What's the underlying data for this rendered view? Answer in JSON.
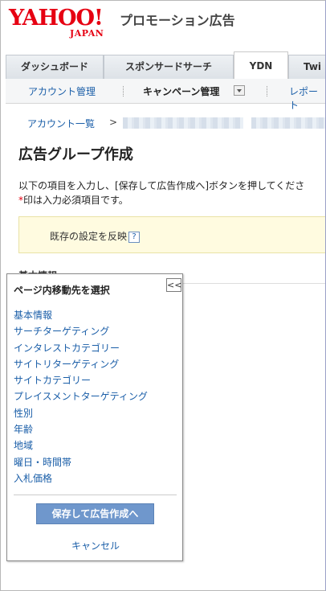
{
  "header": {
    "logo_word": "YAHOO!",
    "logo_sub": "JAPAN",
    "service_name": "プロモーション広告",
    "brand_color": "#e60012"
  },
  "tabs": [
    {
      "label": "ダッシュボード",
      "active": false
    },
    {
      "label": "スポンサードサーチ",
      "active": false
    },
    {
      "label": "YDN",
      "active": true
    },
    {
      "label": "Twi",
      "active": false
    }
  ],
  "subnav": {
    "account_management": "アカウント管理",
    "campaign_management": "キャンペーン管理",
    "reports": "レポート"
  },
  "breadcrumb": {
    "account_list": "アカウント一覧",
    "separator": ">"
  },
  "page": {
    "title": "広告グループ作成",
    "instruction": "以下の項目を入力し、[保存して広告作成へ]ボタンを押してくださ",
    "required_mark": "*",
    "required_note": "印は入力必須項目です。",
    "apply_existing": "既存の設定を反映",
    "help_icon": "?",
    "section_heading": "基本情報"
  },
  "jump_panel": {
    "title": "ページ内移動先を選択",
    "collapse_label": "<<",
    "items": [
      "基本情報",
      "サーチターゲティング",
      "インタレストカテゴリー",
      "サイトリターゲティング",
      "サイトカテゴリー",
      "プレイスメントターゲティング",
      "性別",
      "年齢",
      "地域",
      "曜日・時間帯",
      "入札価格"
    ],
    "save_button": "保存して広告作成へ",
    "cancel_link": "キャンセル"
  }
}
